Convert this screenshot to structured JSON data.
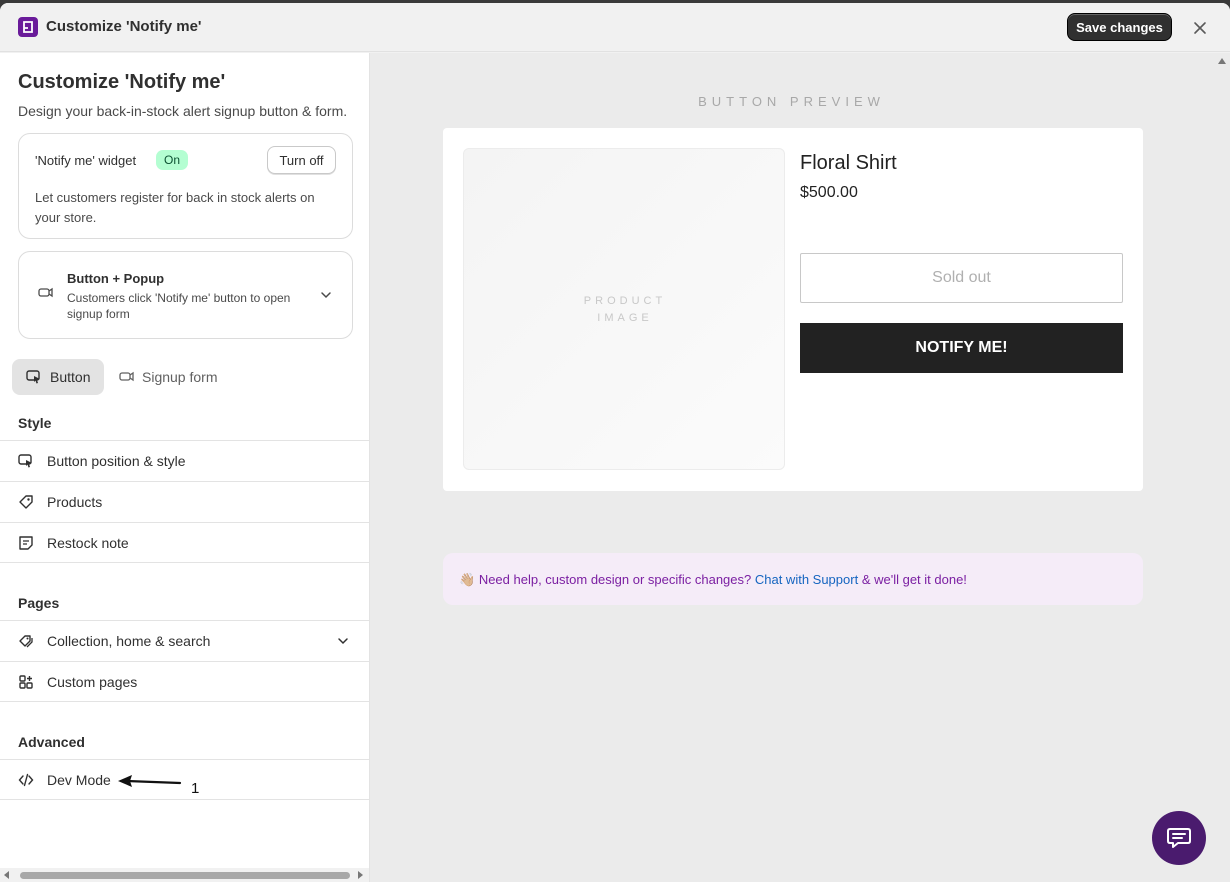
{
  "titlebar": {
    "title": "Customize 'Notify me'",
    "save_label": "Save changes"
  },
  "sidebar": {
    "title": "Customize 'Notify me'",
    "subtitle": "Design your back-in-stock alert signup button & form.",
    "widget_card": {
      "label": "'Notify me' widget",
      "status": "On",
      "toggle_label": "Turn off",
      "description": "Let customers register for back in stock alerts on your store."
    },
    "mode_card": {
      "title": "Button + Popup",
      "description": "Customers click 'Notify me' button to open signup form"
    },
    "tabs": [
      {
        "label": "Button",
        "active": true
      },
      {
        "label": "Signup form",
        "active": false
      }
    ],
    "sections": {
      "style": {
        "heading": "Style",
        "items": [
          {
            "label": "Button position & style",
            "icon": "cursor-click-icon"
          },
          {
            "label": "Products",
            "icon": "tag-icon"
          },
          {
            "label": "Restock note",
            "icon": "note-icon"
          }
        ]
      },
      "pages": {
        "heading": "Pages",
        "items": [
          {
            "label": "Collection, home & search",
            "icon": "tags-icon"
          },
          {
            "label": "Custom pages",
            "icon": "apps-icon"
          }
        ]
      },
      "advanced": {
        "heading": "Advanced",
        "items": [
          {
            "label": "Dev Mode",
            "icon": "code-icon"
          }
        ]
      }
    },
    "annotation": {
      "number": "1"
    }
  },
  "preview": {
    "label": "BUTTON PREVIEW",
    "product": {
      "image_label_line1": "PRODUCT",
      "image_label_line2": "IMAGE",
      "name": "Floral Shirt",
      "price": "$500.00",
      "soldout_label": "Sold out",
      "notify_label": "NOTIFY ME!"
    },
    "help": {
      "emoji": "👋🏼",
      "text_before": "Need help, custom design or specific changes? ",
      "link_text": "Chat with Support",
      "text_after": " & we'll get it done!"
    }
  },
  "colors": {
    "brand": "#6a1b9a",
    "accent_dark": "#303030",
    "badge_on_bg": "#b4fed2",
    "help_bg": "#f5ecf8",
    "help_text": "#7b1fa2",
    "link": "#1565c0",
    "chat_fab": "#4a1b6e"
  }
}
